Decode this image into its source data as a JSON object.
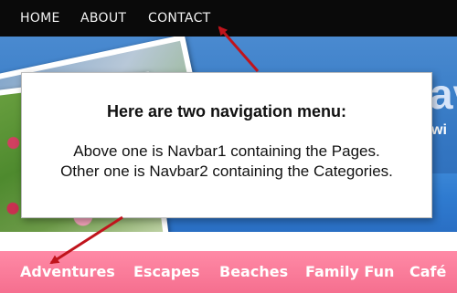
{
  "navbar1": {
    "items": [
      {
        "label": "HOME"
      },
      {
        "label": "ABOUT"
      },
      {
        "label": "CONTACT"
      }
    ]
  },
  "header": {
    "title_fragment": "av",
    "tagline_fragment": "wi"
  },
  "callout": {
    "title": "Here are two navigation menu:",
    "line1": "Above one is Navbar1 containing the Pages.",
    "line2": "Other one is Navbar2 containing the Categories."
  },
  "navbar2": {
    "items": [
      {
        "label": "Adventures"
      },
      {
        "label": "Escapes"
      },
      {
        "label": "Beaches"
      },
      {
        "label": "Family Fun"
      },
      {
        "label": "Café"
      }
    ]
  },
  "colors": {
    "navbar1_bg": "#0a0a0a",
    "navbar2_bg": "#f56f8f",
    "header_bg": "#3c7fc8",
    "arrow": "#c0141c"
  }
}
